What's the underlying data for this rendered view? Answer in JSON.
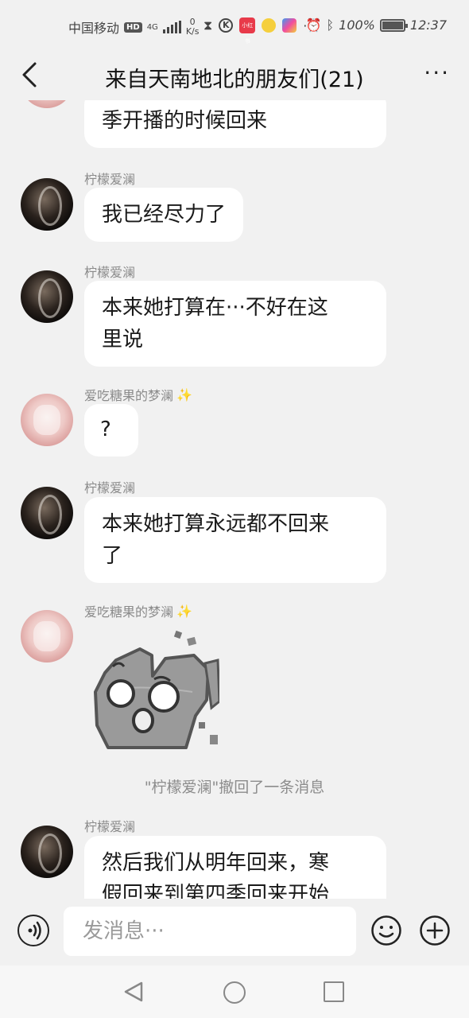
{
  "status_bar": {
    "carrier": "中国移动",
    "hd_badge": "HD",
    "network": "4G",
    "speed_value": "0",
    "speed_unit": "K/s",
    "battery_percent": "100%",
    "time": "12:37",
    "app_badge": "小红书"
  },
  "header": {
    "title": "来自天南地北的朋友们(21)",
    "more_label": "···"
  },
  "messages": [
    {
      "sender": "",
      "text": "季开播的时候回来"
    },
    {
      "sender": "柠檬爱澜",
      "text": "我已经尽力了"
    },
    {
      "sender": "柠檬爱澜",
      "text_line1": "本来她打算在···不好在这",
      "text_line2": "里说"
    },
    {
      "sender": "爱吃糖果的梦澜",
      "text": "?"
    },
    {
      "sender": "柠檬爱澜",
      "text_line1": "本来她打算永远都不回来",
      "text_line2": "了"
    },
    {
      "sender": "爱吃糖果的梦澜",
      "sticker": "cracked-rock-face-sticker"
    },
    {
      "system": "\"柠檬爱澜\"撤回了一条消息"
    },
    {
      "sender": "柠檬爱澜",
      "text_line1": "然后我们从明年回来，寒",
      "text_line2": "假回来到第四季回来开始"
    }
  ],
  "sparkle": "✨",
  "input": {
    "placeholder": "发消息···"
  },
  "icons": {
    "back": "chevron-left-icon",
    "more": "more-dots-icon",
    "voice": "voice-icon",
    "emoji": "emoji-icon",
    "plus": "plus-icon"
  }
}
